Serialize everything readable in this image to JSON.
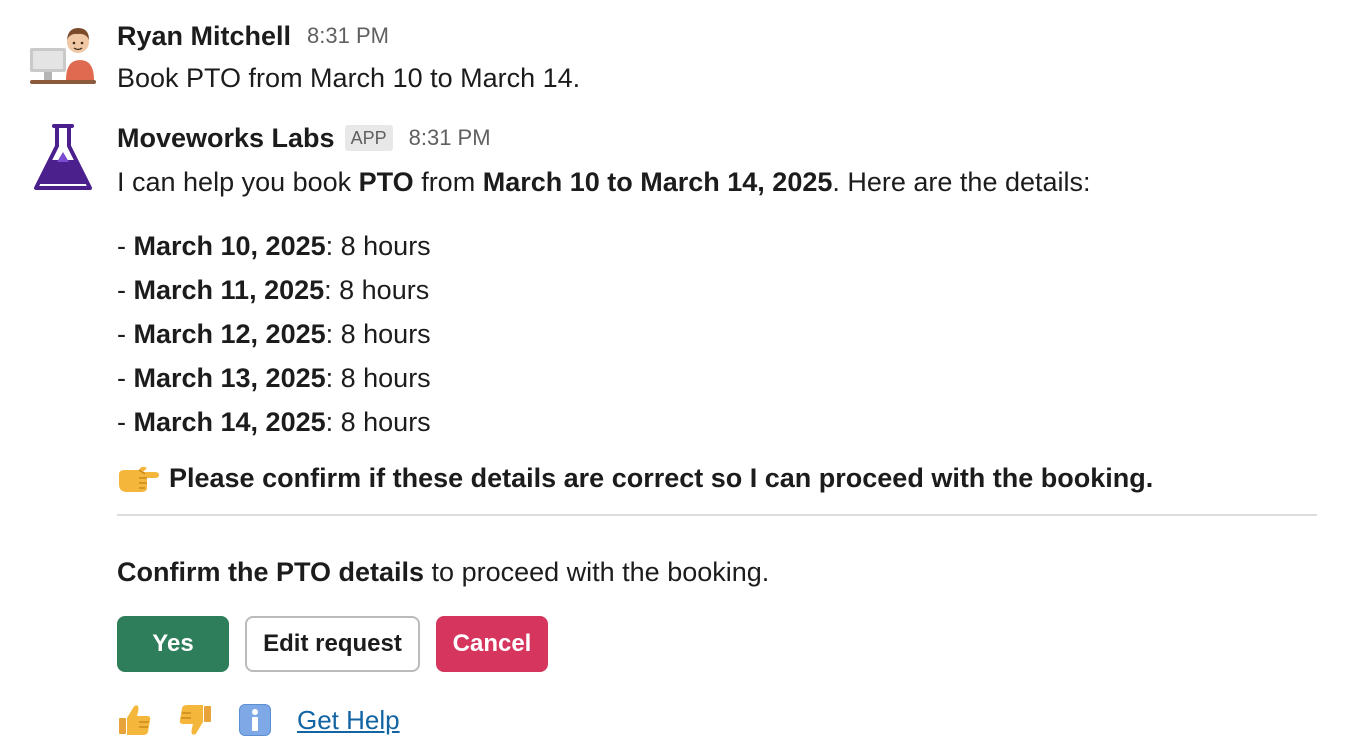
{
  "messages": [
    {
      "author": "Ryan Mitchell",
      "time": "8:31 PM",
      "text": "Book PTO from March 10 to March 14."
    },
    {
      "author": "Moveworks Labs",
      "badge": "APP",
      "time": "8:31 PM",
      "intro": {
        "p1": "I can help you book ",
        "b1": "PTO",
        "p2": " from ",
        "b2": "March 10 to March 14, 2025",
        "p3": ". Here are the details:"
      },
      "entries": [
        {
          "dash": "- ",
          "date": "March 10, 2025",
          "hours": ": 8 hours"
        },
        {
          "dash": "- ",
          "date": "March 11, 2025",
          "hours": ": 8 hours"
        },
        {
          "dash": "- ",
          "date": "March 12, 2025",
          "hours": ": 8 hours"
        },
        {
          "dash": "- ",
          "date": "March 13, 2025",
          "hours": ": 8 hours"
        },
        {
          "dash": "- ",
          "date": "March 14, 2025",
          "hours": ": 8 hours"
        }
      ],
      "confirm_text": "Please confirm if these details are correct so I can proceed with the booking.",
      "prompt": {
        "bold": "Confirm the PTO details",
        "rest": " to proceed with the booking."
      },
      "buttons": {
        "yes": "Yes",
        "edit": "Edit request",
        "cancel": "Cancel"
      },
      "feedback": {
        "help": "Get Help"
      }
    }
  ],
  "icons": {
    "confirm": "pointing-right-icon",
    "thumbs_up": "thumbs-up-icon",
    "thumbs_down": "thumbs-down-icon",
    "info": "info-icon"
  },
  "colors": {
    "yes": "#2e7d5b",
    "cancel": "#d6365e",
    "link": "#1264a3",
    "bot_purple": "#4b1f8c"
  }
}
